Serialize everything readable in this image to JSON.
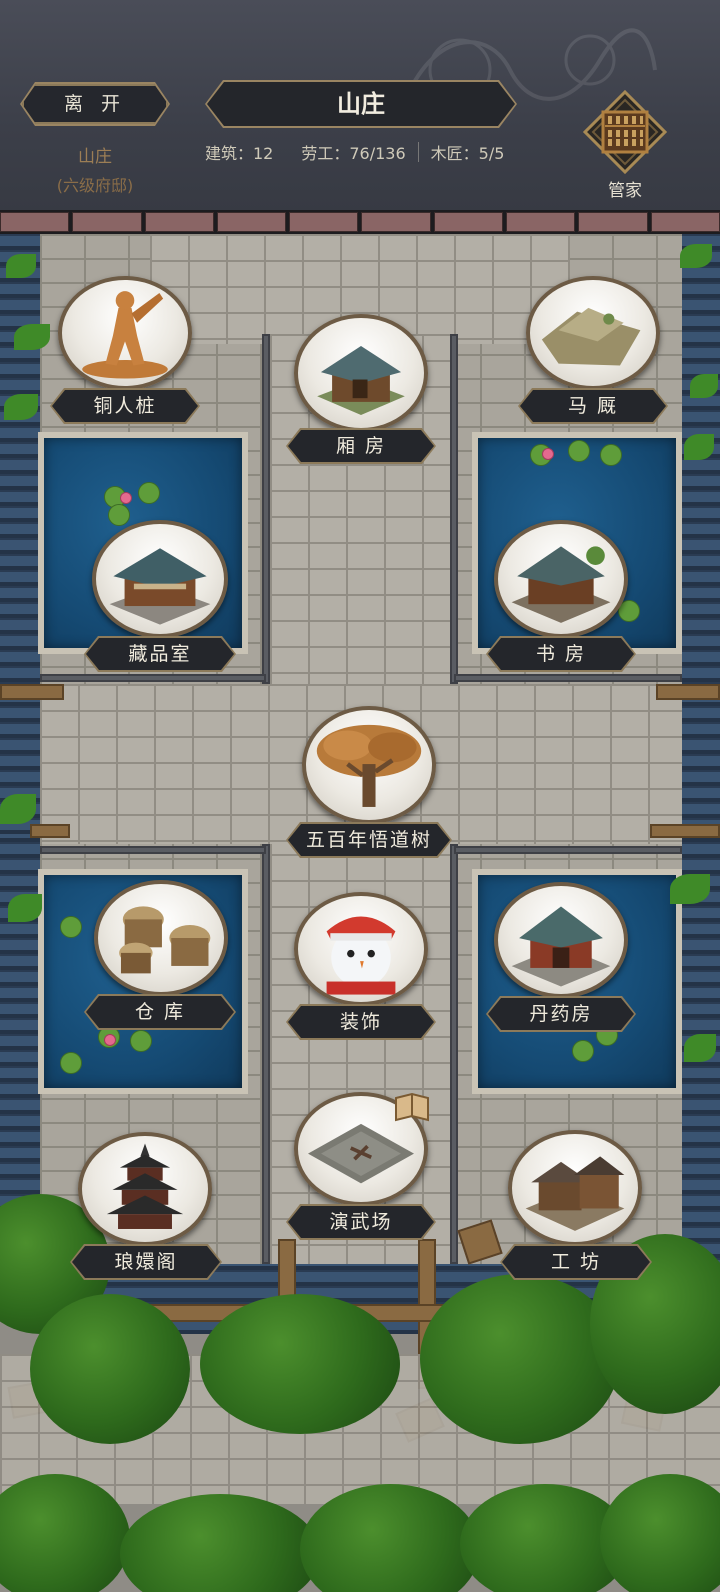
{
  "header": {
    "leave_label": "离 开",
    "title": "山庄",
    "estate_name": "山庄",
    "estate_level": "(六级府邸)",
    "stats": {
      "buildings": "建筑：12",
      "labor": "劳工：76/136",
      "carpenters": "木匠：5/5"
    },
    "steward_label": "管家",
    "steward_icon": "abacus-icon"
  },
  "buildings": {
    "wooden_dummy": "铜人桩",
    "wing_room": "厢 房",
    "stable": "马 厩",
    "collection_room": "藏品室",
    "study": "书 房",
    "dao_tree": "五百年悟道树",
    "warehouse": "仓 库",
    "decoration": "装饰",
    "alchemy_room": "丹药房",
    "pavilion": "琅嬛阁",
    "martial_arena": "演武场",
    "workshop": "工 坊"
  },
  "colors": {
    "panel": "#24262b",
    "gold_border": "#8c7a5a",
    "water": "#1f5f8e",
    "tile_roof": "#2c3e55",
    "label_text": "#f0ebdd"
  }
}
